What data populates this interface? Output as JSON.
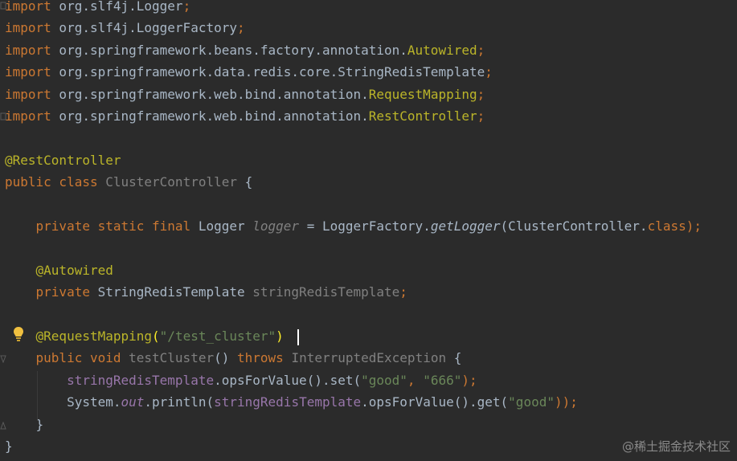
{
  "code_lines": [
    {
      "tokens": [
        {
          "t": "import",
          "c": "kw"
        },
        {
          "t": " org.slf4j.Logger",
          "c": "plain"
        },
        {
          "t": ";",
          "c": "kw"
        }
      ]
    },
    {
      "tokens": [
        {
          "t": "import",
          "c": "kw"
        },
        {
          "t": " org.slf4j.LoggerFactory",
          "c": "plain"
        },
        {
          "t": ";",
          "c": "kw"
        }
      ]
    },
    {
      "tokens": [
        {
          "t": "import",
          "c": "kw"
        },
        {
          "t": " org.springframework.beans.factory.annotation.",
          "c": "plain"
        },
        {
          "t": "Autowired",
          "c": "ann"
        },
        {
          "t": ";",
          "c": "kw"
        }
      ]
    },
    {
      "tokens": [
        {
          "t": "import",
          "c": "kw"
        },
        {
          "t": " org.springframework.data.redis.core.StringRedisTemplate",
          "c": "plain"
        },
        {
          "t": ";",
          "c": "kw"
        }
      ]
    },
    {
      "tokens": [
        {
          "t": "import",
          "c": "kw"
        },
        {
          "t": " org.springframework.web.bind.annotation.",
          "c": "plain"
        },
        {
          "t": "RequestMapping",
          "c": "ann"
        },
        {
          "t": ";",
          "c": "kw"
        }
      ]
    },
    {
      "tokens": [
        {
          "t": "import",
          "c": "kw"
        },
        {
          "t": " org.springframework.web.bind.annotation.",
          "c": "plain"
        },
        {
          "t": "RestController",
          "c": "ann"
        },
        {
          "t": ";",
          "c": "kw"
        }
      ]
    },
    {
      "tokens": []
    },
    {
      "tokens": [
        {
          "t": "@RestController",
          "c": "ann"
        }
      ]
    },
    {
      "tokens": [
        {
          "t": "public class ",
          "c": "kw"
        },
        {
          "t": "ClusterController",
          "c": "grey"
        },
        {
          "t": " {",
          "c": "plain"
        }
      ]
    },
    {
      "tokens": []
    },
    {
      "tokens": [
        {
          "t": "    private static final ",
          "c": "kw"
        },
        {
          "t": "Logger ",
          "c": "plain"
        },
        {
          "t": "logger",
          "c": "grey italic"
        },
        {
          "t": " = LoggerFactory.",
          "c": "plain"
        },
        {
          "t": "getLogger",
          "c": "plain italic"
        },
        {
          "t": "(ClusterController.",
          "c": "plain"
        },
        {
          "t": "class",
          "c": "kw"
        },
        {
          "t": ");",
          "c": "kw"
        }
      ]
    },
    {
      "tokens": []
    },
    {
      "tokens": [
        {
          "t": "    @Autowired",
          "c": "ann"
        }
      ]
    },
    {
      "tokens": [
        {
          "t": "    private ",
          "c": "kw"
        },
        {
          "t": "StringRedisTemplate ",
          "c": "plain"
        },
        {
          "t": "stringRedisTemplate",
          "c": "grey"
        },
        {
          "t": ";",
          "c": "kw"
        }
      ]
    },
    {
      "tokens": []
    },
    {
      "tokens": [
        {
          "t": "    @RequestMapping",
          "c": "ann"
        },
        {
          "t": "(",
          "c": "bold-pn"
        },
        {
          "t": "\"/test_cluster\"",
          "c": "str"
        },
        {
          "t": ")",
          "c": "bold-pn"
        }
      ]
    },
    {
      "tokens": [
        {
          "t": "    public void ",
          "c": "kw"
        },
        {
          "t": "testCluster",
          "c": "grey"
        },
        {
          "t": "() ",
          "c": "plain"
        },
        {
          "t": "throws ",
          "c": "kw"
        },
        {
          "t": "InterruptedException",
          "c": "grey"
        },
        {
          "t": " {",
          "c": "plain"
        }
      ]
    },
    {
      "tokens": [
        {
          "t": "        ",
          "c": "plain"
        },
        {
          "t": "stringRedisTemplate",
          "c": "field"
        },
        {
          "t": ".opsForValue().set(",
          "c": "plain"
        },
        {
          "t": "\"good\"",
          "c": "str"
        },
        {
          "t": ", ",
          "c": "kw"
        },
        {
          "t": "\"666\"",
          "c": "str"
        },
        {
          "t": ");",
          "c": "kw"
        }
      ]
    },
    {
      "tokens": [
        {
          "t": "        System.",
          "c": "plain"
        },
        {
          "t": "out",
          "c": "field italic"
        },
        {
          "t": ".println(",
          "c": "plain"
        },
        {
          "t": "stringRedisTemplate",
          "c": "field"
        },
        {
          "t": ".opsForValue().get(",
          "c": "plain"
        },
        {
          "t": "\"good\"",
          "c": "str"
        },
        {
          "t": "));",
          "c": "kw"
        }
      ]
    },
    {
      "tokens": [
        {
          "t": "    }",
          "c": "plain"
        }
      ]
    },
    {
      "tokens": [
        {
          "t": "}",
          "c": "plain"
        }
      ]
    }
  ],
  "watermark": "@稀土掘金技术社区",
  "icons": {
    "intention": "lightbulb-icon"
  },
  "colors": {
    "background": "#2b2b2b",
    "keyword": "#cc7832",
    "annotation": "#bbb529",
    "string": "#6a8759",
    "field": "#9876aa"
  }
}
